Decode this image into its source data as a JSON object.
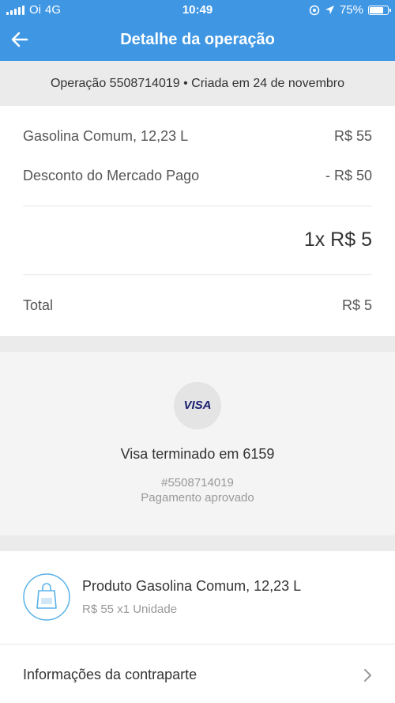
{
  "status_bar": {
    "carrier": "Oi",
    "network": "4G",
    "time": "10:49",
    "battery": "75%",
    "battery_level": 0.75
  },
  "app_bar": {
    "title": "Detalhe da operação",
    "back_icon": "arrow-left-icon"
  },
  "operation": {
    "header": "Operação 5508714019 • Criada em 24 de novembro"
  },
  "items": [
    {
      "label": "Gasolina Comum, 12,23 L",
      "value": "R$ 55"
    },
    {
      "label": "Desconto do Mercado Pago",
      "value": "- R$ 50"
    }
  ],
  "quantity_line": "1x R$ 5",
  "total": {
    "label": "Total",
    "value": "R$ 5"
  },
  "payment": {
    "brand": "VISA",
    "title": "Visa terminado em 6159",
    "id": "#5508714019",
    "status": "Pagamento aprovado"
  },
  "product": {
    "icon": "shopping-bag-icon",
    "name": "Produto Gasolina Comum, 12,23 L",
    "detail": "R$ 55 x1 Unidade"
  },
  "counterpart": {
    "label": "Informações da contraparte"
  },
  "colors": {
    "primary": "#3f97e4",
    "background": "#ebebeb",
    "icon_accent": "#5ab2e8"
  }
}
